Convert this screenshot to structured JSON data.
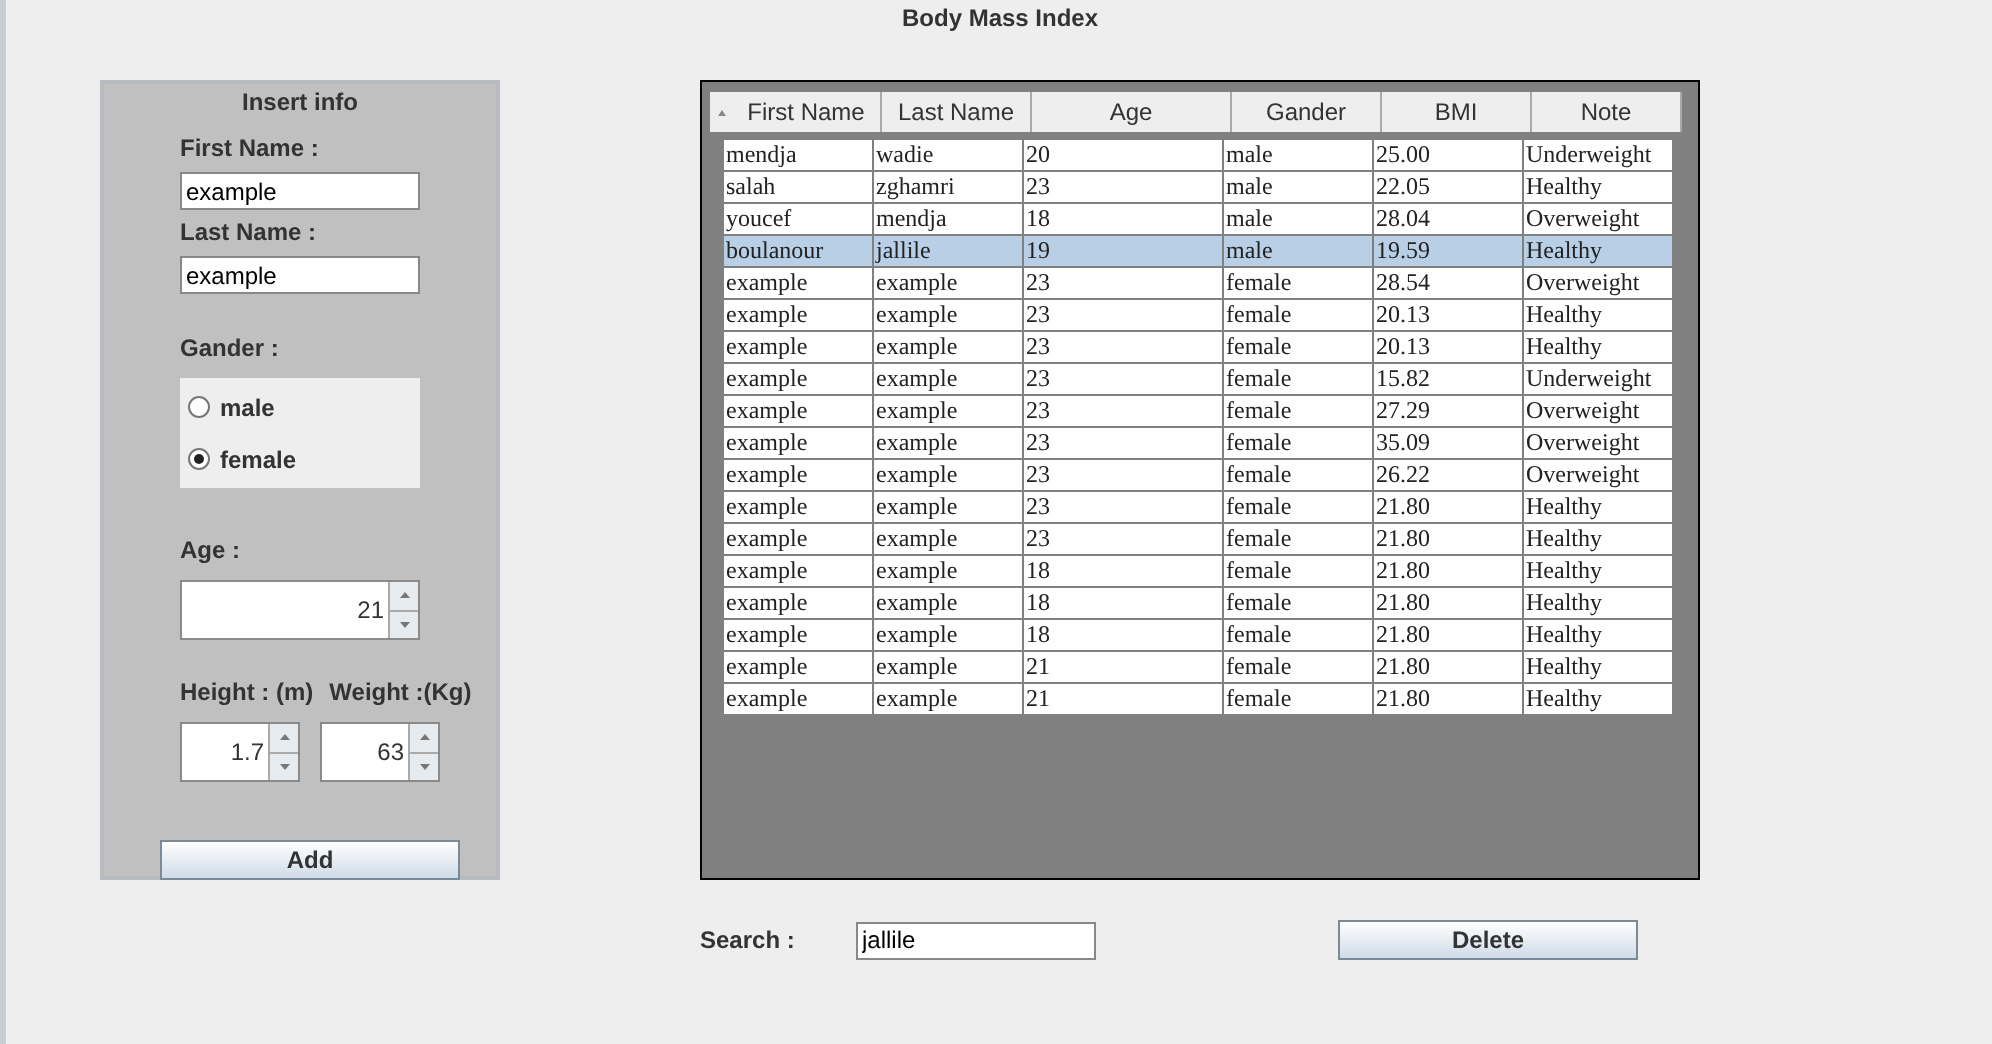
{
  "window": {
    "title": "Body Mass Index"
  },
  "form": {
    "title": "Insert info",
    "first_name": {
      "label": "First Name :",
      "value": "example"
    },
    "last_name": {
      "label": "Last Name :",
      "value": "example"
    },
    "gender": {
      "label": "Gander :",
      "options": [
        {
          "label": "male",
          "selected": false
        },
        {
          "label": "female",
          "selected": true
        }
      ]
    },
    "age": {
      "label": "Age :",
      "value": "21"
    },
    "height": {
      "label": "Height : (m)",
      "value": "1.7"
    },
    "weight": {
      "label": "Weight :(Kg)",
      "value": "63"
    },
    "add_button": "Add"
  },
  "table": {
    "columns": [
      "First Name",
      "Last Name",
      "Age",
      "Gander",
      "BMI",
      "Note"
    ],
    "rows": [
      {
        "cells": [
          "mendja",
          "wadie",
          "20",
          "male",
          "25.00",
          "Underweight"
        ],
        "selected": false
      },
      {
        "cells": [
          "salah",
          "zghamri",
          "23",
          "male",
          "22.05",
          "Healthy"
        ],
        "selected": false
      },
      {
        "cells": [
          "youcef",
          "mendja",
          "18",
          "male",
          "28.04",
          "Overweight"
        ],
        "selected": false
      },
      {
        "cells": [
          "boulanour",
          "jallile",
          "19",
          "male",
          "19.59",
          "Healthy"
        ],
        "selected": true
      },
      {
        "cells": [
          "example",
          "example",
          "23",
          "female",
          "28.54",
          "Overweight"
        ],
        "selected": false
      },
      {
        "cells": [
          "example",
          "example",
          "23",
          "female",
          "20.13",
          "Healthy"
        ],
        "selected": false
      },
      {
        "cells": [
          "example",
          "example",
          "23",
          "female",
          "20.13",
          "Healthy"
        ],
        "selected": false
      },
      {
        "cells": [
          "example",
          "example",
          "23",
          "female",
          "15.82",
          "Underweight"
        ],
        "selected": false
      },
      {
        "cells": [
          "example",
          "example",
          "23",
          "female",
          "27.29",
          "Overweight"
        ],
        "selected": false
      },
      {
        "cells": [
          "example",
          "example",
          "23",
          "female",
          "35.09",
          "Overweight"
        ],
        "selected": false
      },
      {
        "cells": [
          "example",
          "example",
          "23",
          "female",
          "26.22",
          "Overweight"
        ],
        "selected": false
      },
      {
        "cells": [
          "example",
          "example",
          "23",
          "female",
          "21.80",
          "Healthy"
        ],
        "selected": false
      },
      {
        "cells": [
          "example",
          "example",
          "23",
          "female",
          "21.80",
          "Healthy"
        ],
        "selected": false
      },
      {
        "cells": [
          "example",
          "example",
          "18",
          "female",
          "21.80",
          "Healthy"
        ],
        "selected": false
      },
      {
        "cells": [
          "example",
          "example",
          "18",
          "female",
          "21.80",
          "Healthy"
        ],
        "selected": false
      },
      {
        "cells": [
          "example",
          "example",
          "18",
          "female",
          "21.80",
          "Healthy"
        ],
        "selected": false
      },
      {
        "cells": [
          "example",
          "example",
          "21",
          "female",
          "21.80",
          "Healthy"
        ],
        "selected": false
      },
      {
        "cells": [
          "example",
          "example",
          "21",
          "female",
          "21.80",
          "Healthy"
        ],
        "selected": false
      }
    ]
  },
  "search": {
    "label": "Search :",
    "value": "jallile"
  },
  "delete_button": "Delete"
}
